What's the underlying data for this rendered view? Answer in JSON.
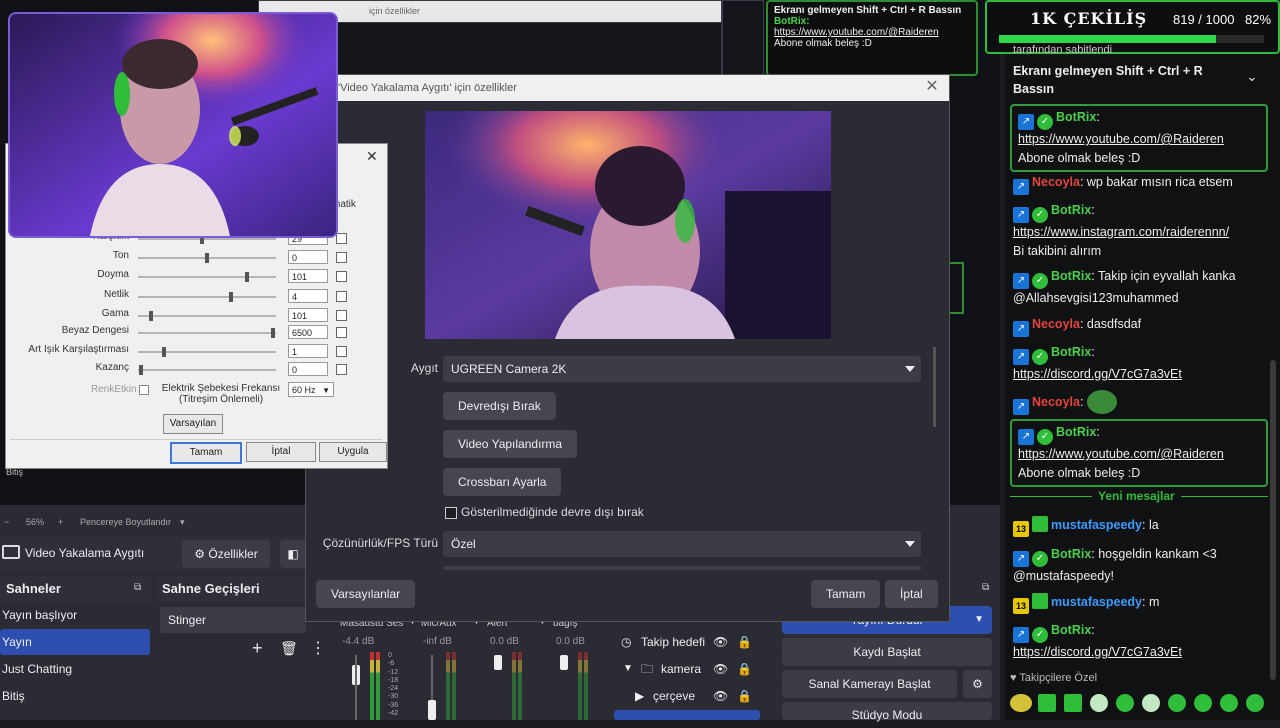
{
  "colors": {
    "accent_green": "#2fbd3a",
    "obs_bg": "#2a2b33",
    "selected_scene": "#2f4fb0",
    "bot_blue": "#1a73d6",
    "user_red": "#e2453c"
  },
  "background_windows": {
    "title_fragment": "için özellikler",
    "chat_fragment_title": "Ekranı gelmeyen Shift + Ctrl + R Bassın",
    "chat_fragment_user": "BotRix:",
    "chat_fragment_link": "https://www.youtube.com/@Raideren",
    "chat_fragment_text": "Abone olmak beleş :D"
  },
  "obs": {
    "zoom": {
      "minus": "−",
      "value": "56%",
      "plus": "+",
      "fit": "Pencereye Boyutlandır",
      "caret": "▾"
    },
    "source_bar": {
      "camera_icon": "camera-icon",
      "source_name": "Video Yakalama Aygıtı",
      "properties_label": "Özellikler"
    },
    "docks": {
      "scenes_title": "Sahneler",
      "transitions_title": "Sahne Geçişleri",
      "transition_value": "Stinger",
      "scenes": [
        "Yayın başlıyor",
        "Yayın",
        "Just Chatting",
        "Bitiş"
      ],
      "selected_scene": "Yayın"
    },
    "mixer": {
      "channels": [
        {
          "name": "Masaüstü Ses",
          "db": "-4.4 dB"
        },
        {
          "name": "Mic/Aux",
          "db": "-inf dB"
        },
        {
          "name": "Alert",
          "db": "0.0 dB"
        },
        {
          "name": "bağış",
          "db": "0.0 dB"
        }
      ],
      "scale": [
        "0",
        "-6",
        "-12",
        "-18",
        "-24",
        "-30",
        "-36",
        "-42"
      ]
    },
    "sources": [
      "Takip hedefi",
      "kamera",
      "çerçeve"
    ],
    "controls": {
      "stop_stream": "Yayını Durdur",
      "start_record": "Kaydı Başlat",
      "virtual_cam": "Sanal Kamerayı Başlat",
      "studio_mode": "Stüdyo Modu"
    },
    "bottom_left_label": "Bitiş"
  },
  "properties_dialog": {
    "title": "'Video Yakalama Aygıtı' için özellikler",
    "device_label": "Aygıt",
    "device_value": "UGREEN Camera 2K",
    "btn_deactivate": "Devredışı Bırak",
    "btn_video_config": "Video Yapılandırma",
    "btn_crossbar": "Crossbarı Ayarla",
    "checkbox_label": "Gösterilmediğinde devre dışı bırak",
    "checkbox_checked": false,
    "res_label": "Çözünürlük/FPS Türü",
    "res_value": "Özel",
    "btn_defaults": "Varsayılanlar",
    "btn_ok": "Tamam",
    "btn_cancel": "İptal"
  },
  "video_proc_dialog": {
    "auto_fragment": "matik",
    "rows": [
      {
        "label": "Karşıtlık",
        "value": "29",
        "pos": 0.46
      },
      {
        "label": "Ton",
        "value": "0",
        "pos": 0.5
      },
      {
        "label": "Doyma",
        "value": "101",
        "pos": 0.8
      },
      {
        "label": "Netlik",
        "value": "4",
        "pos": 0.68
      },
      {
        "label": "Gama",
        "value": "101",
        "pos": 0.08
      },
      {
        "label": "Beyaz Dengesi",
        "value": "6500",
        "pos": 0.99
      },
      {
        "label": "Art Işık Karşılaştırması",
        "value": "1",
        "pos": 0.18
      },
      {
        "label": "Kazanç",
        "value": "0",
        "pos": 0.01
      }
    ],
    "color_enable": "RenkEtkin",
    "powerline_label": "Elektrik Şebekesi Frekansı\n(Titreşim Önlemeli)",
    "powerline_value": "60 Hz",
    "btn_defaults": "Varsayılan",
    "btn_ok": "Tamam",
    "btn_cancel": "İptal",
    "btn_apply": "Uygula"
  },
  "chat": {
    "banner": {
      "title": "1K ÇEKİLİŞ",
      "count": "819 / 1000",
      "percent_text": "82%",
      "progress": 0.82
    },
    "pinned": {
      "by": "tarafından sabitlendi",
      "text": "Ekranı gelmeyen Shift + Ctrl + R Bassın"
    },
    "new_messages": "Yeni mesajlar",
    "messages": [
      {
        "user": "BotRix",
        "text": "https://www.youtube.com/@Raideren",
        "text2": "Abone olmak beleş :D"
      },
      {
        "user": "Necoyla",
        "text": "wp bakar mısın rica etsem"
      },
      {
        "user": "BotRix",
        "text": "https://www.instagram.com/raiderennn/",
        "text2": "Bi takibini alırım"
      },
      {
        "user": "BotRix",
        "text": "Takip için eyvallah kanka @Allahsevgisi123muhammed"
      },
      {
        "user": "Necoyla",
        "text": "dasdfsdaf"
      },
      {
        "user": "BotRix",
        "text": "https://discord.gg/V7cG7a3vEt"
      },
      {
        "user": "Necoyla",
        "text": ""
      },
      {
        "user": "BotRix",
        "text": "https://www.youtube.com/@Raideren",
        "text2": "Abone olmak beleş :D"
      },
      {
        "user": "mustafaspeedy",
        "badge": "13",
        "text": "la"
      },
      {
        "user": "BotRix",
        "text": "hoşgeldin kankam <3 @mustafaspeedy!"
      },
      {
        "user": "mustafaspeedy",
        "badge": "13",
        "text": "m"
      },
      {
        "user": "BotRix",
        "text": "https://discord.gg/V7cG7a3vEt"
      }
    ],
    "footer_label": "Takipçilere Özel"
  }
}
